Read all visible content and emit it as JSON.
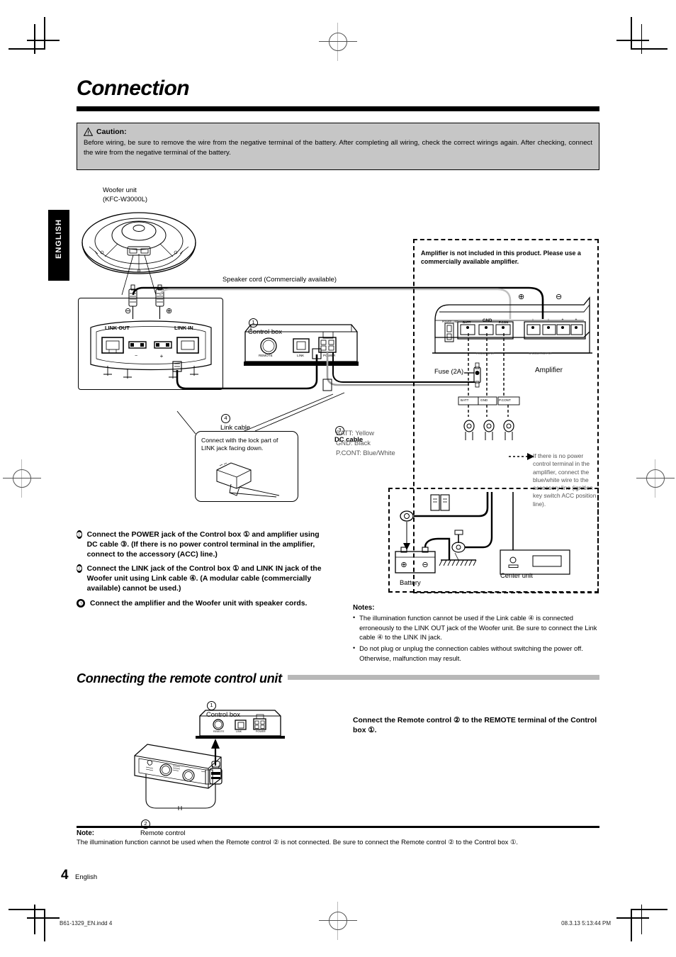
{
  "page": {
    "title": "Connection",
    "language_tab": "ENGLISH",
    "page_number": "4",
    "page_language": "English",
    "footer_left": "B61-1329_EN.indd   4",
    "footer_right": "08.3.13   5:13:44 PM"
  },
  "caution": {
    "icon": "warning-triangle-icon",
    "heading": "Caution:",
    "body": "Before wiring, be sure to remove the wire from the negative terminal of the battery. After completing all wiring, check the correct wirings again. After checking, connect the wire from the negative terminal of the battery."
  },
  "diagram": {
    "woofer_label_line1": "Woofer unit",
    "woofer_label_line2": "(KFC-W3000L)",
    "speaker_cord": "Speaker cord (Commercially available)",
    "control_box": "Control box",
    "control_box_num": "1",
    "woofer_ports": {
      "link_out": "LINK OUT",
      "link_in": "LINK IN",
      "minus": "⊖",
      "plus": "⊕"
    },
    "control_box_ports": {
      "remote": "REMOTE",
      "link": "LINK",
      "power": "POWER"
    },
    "amplifier_note": "Amplifier is not included in this product.\nPlease use a commercially available amplifier.",
    "amplifier_label": "Amplifier",
    "fuse_label": "Fuse (2A)",
    "amp_terminals": {
      "power_line": "POWER LINE",
      "batt": "BATT",
      "gnd": "GND",
      "pcon": "P.CON",
      "speaker_output": "SPEAKER OUTPUT",
      "power_input": "POWER INPUT"
    },
    "dc_tags": [
      "BATT",
      "GND",
      "P.CONT"
    ],
    "link_cable": "Link cable",
    "link_cable_num": "4",
    "callout": "Connect with the lock part of LINK jack facing down.",
    "dc_cable": "DC cable",
    "dc_cable_num": "3",
    "dc_cable_legend": [
      "BATT: Yellow",
      "GND: Black",
      "P.CONT: Blue/White"
    ],
    "acc_note": "If there is no power control terminal in the amplifier, connect the blue/white wire to the accessory line (ignition key switch ACC position line).",
    "battery_label": "Battery",
    "center_unit_label": "Center unit"
  },
  "steps": [
    {
      "num": "❶",
      "text": "Connect the POWER jack of the Control box ① and amplifier using DC cable ③. (If there is no power control terminal in the amplifier, connect to the accessory (ACC) line.)"
    },
    {
      "num": "❷",
      "text": "Connect the LINK jack of the Control box ① and LINK IN jack of the Woofer unit using Link cable ④. (A modular cable (commercially available) cannot be used.)"
    },
    {
      "num": "❸",
      "text": "Connect the amplifier and the Woofer unit with speaker cords."
    }
  ],
  "notes": {
    "title": "Notes:",
    "items": [
      "The illumination function cannot be used if the Link cable ④ is connected erroneously to the LINK OUT jack of the Woofer unit. Be sure to connect the Link cable ④ to the LINK IN jack.",
      "Do not plug or unplug the connection cables without switching the power off. Otherwise, malfunction may result."
    ]
  },
  "remote_section": {
    "heading": "Connecting the remote control unit",
    "control_box_label": "Control box",
    "control_box_num": "1",
    "remote_control_label": "Remote control",
    "remote_control_num": "2",
    "ports": {
      "remote": "REMOTE",
      "link": "LINK",
      "power": "POWER"
    },
    "instruction": "Connect the Remote control ② to the REMOTE terminal of the Control box ①."
  },
  "bottom_note": {
    "title": "Note:",
    "text": "The illumination function cannot be used when the Remote control ② is not connected. Be sure to connect the Remote control ② to the Control box ①."
  }
}
